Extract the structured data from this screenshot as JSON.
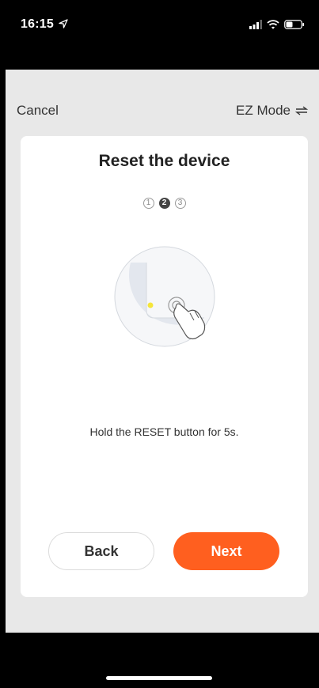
{
  "status_bar": {
    "time": "16:15",
    "icons": [
      "location-arrow-icon",
      "signal-icon",
      "wifi-icon",
      "battery-icon"
    ]
  },
  "nav": {
    "cancel_label": "Cancel",
    "mode_label": "EZ Mode",
    "mode_icon": "switch-arrows-icon"
  },
  "card": {
    "title": "Reset the device",
    "steps": [
      {
        "label": "1",
        "active": false
      },
      {
        "label": "2",
        "active": true
      },
      {
        "label": "3",
        "active": false
      }
    ],
    "instruction": "Hold the RESET button for 5s.",
    "back_label": "Back",
    "next_label": "Next"
  },
  "colors": {
    "accent": "#ff5f1f",
    "indicator_dot": "#f5e53a",
    "sheet_bg": "#e8e8e8"
  }
}
